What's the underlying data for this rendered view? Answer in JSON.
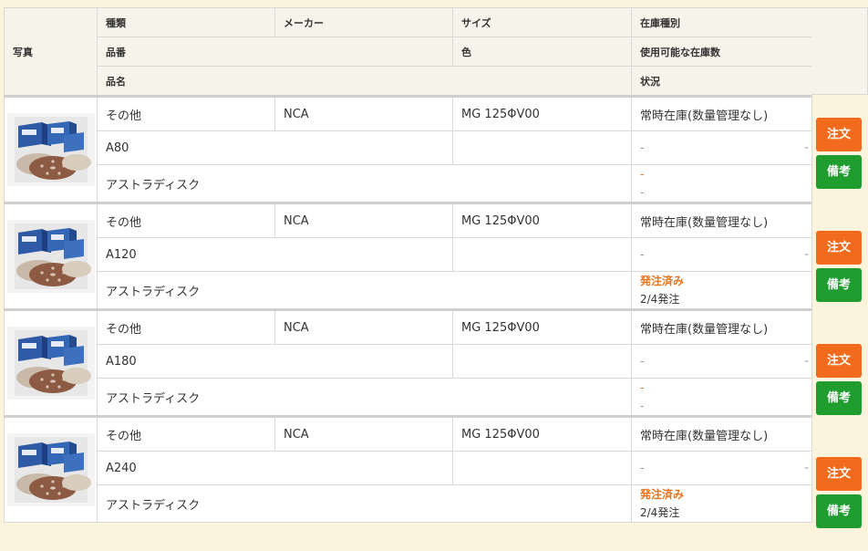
{
  "header": {
    "photo": "写真",
    "type": "種類",
    "maker": "メーカー",
    "size": "サイズ",
    "stock_type": "在庫種別",
    "part_no": "品番",
    "color": "色",
    "available_stock": "使用可能な在庫数",
    "product_name": "品名",
    "status": "状況"
  },
  "buttons": {
    "order": "注文",
    "note": "備考"
  },
  "rows": [
    {
      "type": "その他",
      "maker": "NCA",
      "size": "MG 125ΦV00",
      "stock_type": "常時在庫(数量管理なし)",
      "part_no": "A80",
      "color": "",
      "available_stock": "-",
      "available_stock_right": "-",
      "product_name": "アストラディスク",
      "status_main": "-",
      "status_sub": "-"
    },
    {
      "type": "その他",
      "maker": "NCA",
      "size": "MG 125ΦV00",
      "stock_type": "常時在庫(数量管理なし)",
      "part_no": "A120",
      "color": "",
      "available_stock": "-",
      "available_stock_right": "-",
      "product_name": "アストラディスク",
      "status_main": "発注済み",
      "status_sub": "2/4発注"
    },
    {
      "type": "その他",
      "maker": "NCA",
      "size": "MG 125ΦV00",
      "stock_type": "常時在庫(数量管理なし)",
      "part_no": "A180",
      "color": "",
      "available_stock": "-",
      "available_stock_right": "-",
      "product_name": "アストラディスク",
      "status_main": "-",
      "status_sub": "-"
    },
    {
      "type": "その他",
      "maker": "NCA",
      "size": "MG 125ΦV00",
      "stock_type": "常時在庫(数量管理なし)",
      "part_no": "A240",
      "color": "",
      "available_stock": "-",
      "available_stock_right": "-",
      "product_name": "アストラディスク",
      "status_main": "発注済み",
      "status_sub": "2/4発注"
    }
  ],
  "colors": {
    "order_button": "#f26a1b",
    "note_button": "#1f9e2f",
    "ordered_status": "#e8731a"
  }
}
